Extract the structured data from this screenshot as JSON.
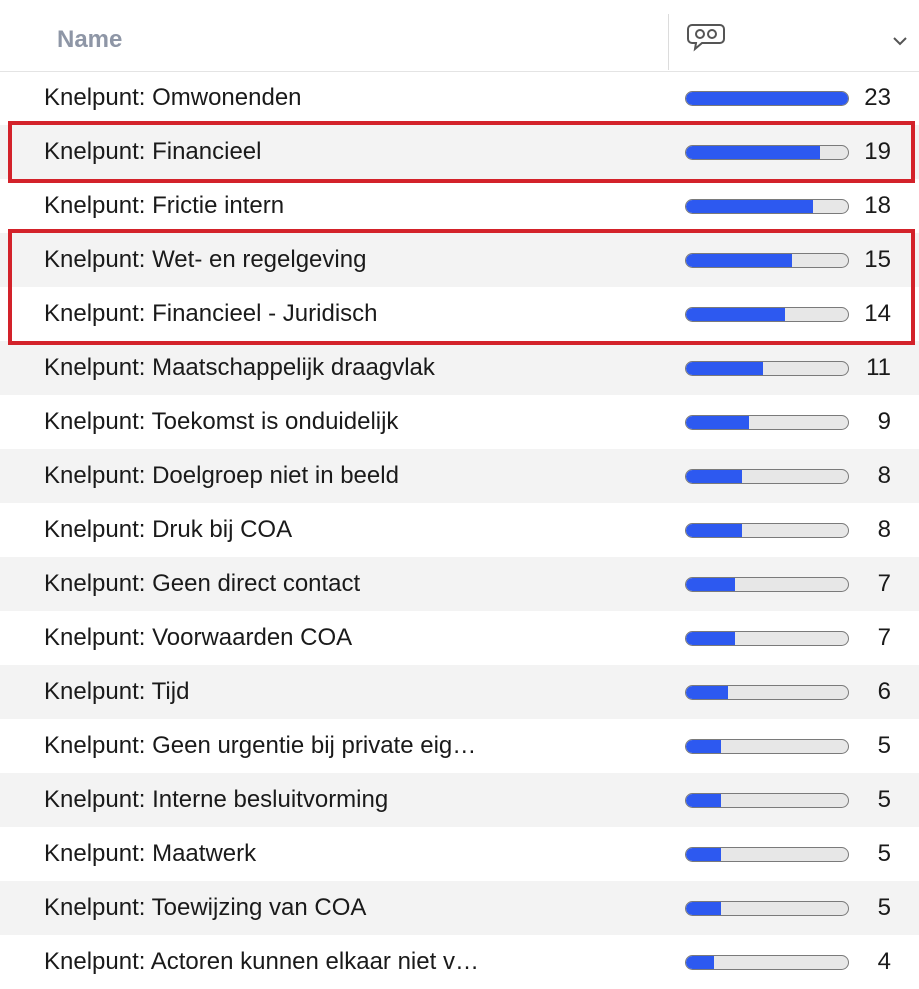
{
  "header": {
    "name_label": "Name",
    "comment_icon": "speech-bubble-icon",
    "sort_icon": "chevron-down-icon"
  },
  "colors": {
    "bar_fill": "#2d59f0",
    "highlight": "#d3222a",
    "header_text": "#8e96a6"
  },
  "max_count": 23,
  "rows": [
    {
      "label": "Knelpunt: Omwonenden",
      "count": "23",
      "value": 23
    },
    {
      "label": "Knelpunt: Financieel",
      "count": "19",
      "value": 19
    },
    {
      "label": "Knelpunt: Frictie intern",
      "count": "18",
      "value": 18
    },
    {
      "label": "Knelpunt: Wet- en regelgeving",
      "count": "15",
      "value": 15
    },
    {
      "label": "Knelpunt: Financieel - Juridisch",
      "count": "14",
      "value": 14
    },
    {
      "label": "Knelpunt: Maatschappelijk draagvlak",
      "count": "11",
      "value": 11
    },
    {
      "label": "Knelpunt: Toekomst is onduidelijk",
      "count": "9",
      "value": 9
    },
    {
      "label": "Knelpunt: Doelgroep niet in beeld",
      "count": "8",
      "value": 8
    },
    {
      "label": "Knelpunt: Druk bij COA",
      "count": "8",
      "value": 8
    },
    {
      "label": "Knelpunt: Geen direct contact",
      "count": "7",
      "value": 7
    },
    {
      "label": "Knelpunt: Voorwaarden COA",
      "count": "7",
      "value": 7
    },
    {
      "label": "Knelpunt: Tijd",
      "count": "6",
      "value": 6
    },
    {
      "label": "Knelpunt: Geen urgentie bij private eig…",
      "count": "5",
      "value": 5
    },
    {
      "label": "Knelpunt: Interne besluitvorming",
      "count": "5",
      "value": 5
    },
    {
      "label": "Knelpunt: Maatwerk",
      "count": "5",
      "value": 5
    },
    {
      "label": "Knelpunt: Toewijzing van COA",
      "count": "5",
      "value": 5
    },
    {
      "label": "Knelpunt: Actoren kunnen elkaar niet v…",
      "count": "4",
      "value": 4
    }
  ],
  "highlighted_rows": [
    [
      1,
      1
    ],
    [
      3,
      4
    ]
  ]
}
